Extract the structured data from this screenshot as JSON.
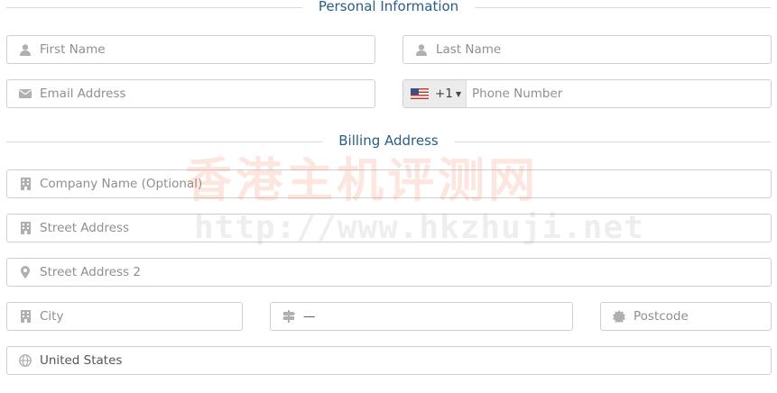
{
  "sections": {
    "personal_title": "Personal Information",
    "billing_title": "Billing Address"
  },
  "personal": {
    "first_name": {
      "placeholder": "First Name",
      "icon": "user-icon"
    },
    "last_name": {
      "placeholder": "Last Name",
      "icon": "user-icon"
    },
    "email": {
      "placeholder": "Email Address",
      "icon": "envelope-icon"
    },
    "phone": {
      "dial_code": "+1",
      "country_flag": "us-flag-icon",
      "placeholder": "Phone Number"
    }
  },
  "billing": {
    "company": {
      "placeholder": "Company Name (Optional)",
      "icon": "building-icon"
    },
    "street1": {
      "placeholder": "Street Address",
      "icon": "building-icon"
    },
    "street2": {
      "placeholder": "Street Address 2",
      "icon": "map-marker-icon"
    },
    "city": {
      "placeholder": "City",
      "icon": "building-icon"
    },
    "state": {
      "value": "—",
      "icon": "signpost-icon"
    },
    "postcode": {
      "placeholder": "Postcode",
      "icon": "certificate-icon"
    },
    "country": {
      "value": "United States",
      "icon": "globe-icon"
    }
  },
  "watermark": {
    "text": "香港主机评测网",
    "url": "http://www.hkzhuji.net"
  }
}
